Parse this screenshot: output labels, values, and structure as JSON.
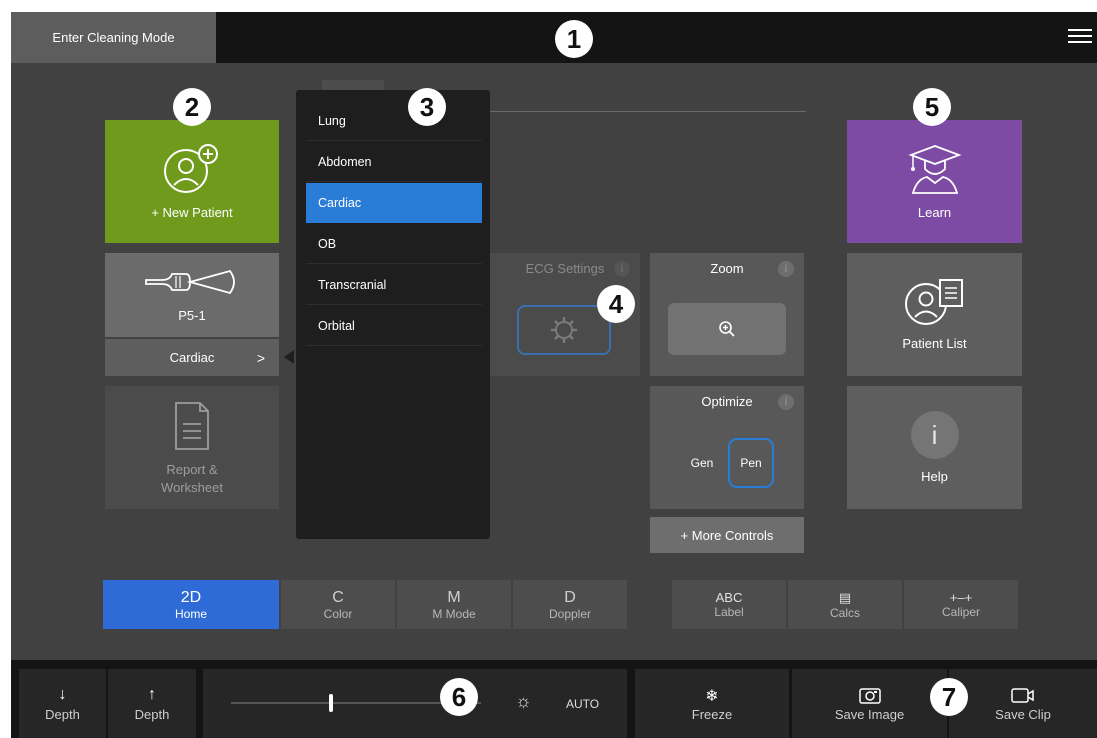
{
  "top_bar": {
    "cleaning_mode_label": "Enter Cleaning Mode",
    "menu_icon": "hamburger-icon"
  },
  "callouts": [
    "1",
    "2",
    "3",
    "4",
    "5",
    "6",
    "7"
  ],
  "left_tiles": {
    "new_patient": {
      "label": "+ New Patient",
      "icon": "add-patient-icon",
      "color": "#6f9a1c"
    },
    "transducer": {
      "label": "P5-1",
      "icon": "transducer-icon"
    },
    "exam_selector": {
      "label": "Cardiac",
      "icon": "chevron-right-icon"
    },
    "report": {
      "line1": "Report &",
      "line2": "Worksheet",
      "icon": "document-icon"
    }
  },
  "exam_menu": {
    "items": [
      "Lung",
      "Abdomen",
      "Cardiac",
      "OB",
      "Transcranial",
      "Orbital"
    ],
    "selected": "Cardiac",
    "selected_color": "#2a7dd6"
  },
  "controls": {
    "ecg": {
      "title": "ECG Settings",
      "info": "i",
      "icon": "gear-icon"
    },
    "zoom": {
      "title": "Zoom",
      "info": "i",
      "icon": "zoom-in-icon"
    },
    "optimize": {
      "title": "Optimize",
      "info": "i",
      "options": [
        "Gen",
        "Pen"
      ],
      "selected": "Pen"
    },
    "more": {
      "label": "+ More Controls"
    }
  },
  "right_tiles": {
    "learn": {
      "label": "Learn",
      "icon": "graduation-icon",
      "color": "#7d4ba3"
    },
    "patient_list": {
      "label": "Patient List",
      "icon": "patient-list-icon"
    },
    "help": {
      "label": "Help",
      "icon": "info-icon",
      "glyph": "i"
    }
  },
  "imaging_modes": [
    {
      "key": "2D",
      "label": "Home",
      "active": true
    },
    {
      "key": "C",
      "label": "Color",
      "active": false
    },
    {
      "key": "M",
      "label": "M Mode",
      "active": false
    },
    {
      "key": "D",
      "label": "Doppler",
      "active": false
    }
  ],
  "tools": [
    {
      "key": "ABC",
      "label": "Label",
      "icon": "label-icon"
    },
    {
      "key": "▤",
      "label": "Calcs",
      "icon": "calculator-icon"
    },
    {
      "key": "+–+",
      "label": "Caliper",
      "icon": "caliper-icon"
    }
  ],
  "bottom_bar": {
    "depth_down": {
      "label": "Depth",
      "icon": "arrow-down-icon",
      "glyph": "↓"
    },
    "depth_up": {
      "label": "Depth",
      "icon": "arrow-up-icon",
      "glyph": "↑"
    },
    "gain": {
      "auto_label": "AUTO",
      "icon": "brightness-icon",
      "glyph": "☼",
      "level": 0.4
    },
    "freeze": {
      "label": "Freeze",
      "icon": "snowflake-icon",
      "glyph": "❄"
    },
    "save_image": {
      "label": "Save Image",
      "icon": "camera-icon"
    },
    "save_clip": {
      "label": "Save Clip",
      "icon": "video-icon"
    }
  }
}
